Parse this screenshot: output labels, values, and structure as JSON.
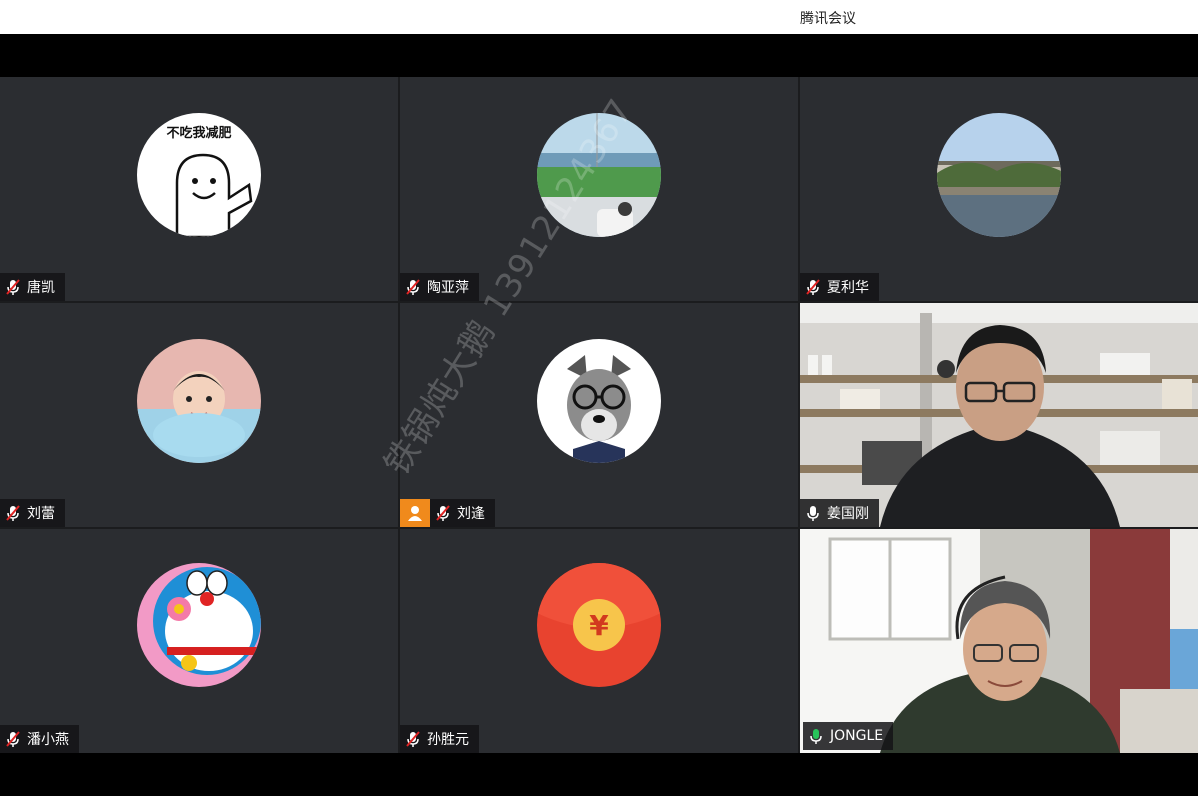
{
  "window": {
    "title": "腾讯会议"
  },
  "watermark": "铁锅炖大鹅 13912124367",
  "participants": [
    {
      "name": "唐凯",
      "avatar": "meme-face-avatar",
      "avatar_text": "不吃我减肥",
      "mic": "muted"
    },
    {
      "name": "陶亚萍",
      "avatar": "beach-resort-avatar",
      "mic": "muted"
    },
    {
      "name": "夏利华",
      "avatar": "river-town-avatar",
      "mic": "muted"
    },
    {
      "name": "刘蕾",
      "avatar": "child-photo-avatar",
      "mic": "muted"
    },
    {
      "name": "刘逢",
      "avatar": "dog-with-glasses-avatar",
      "mic": "muted",
      "badge": "user-icon"
    },
    {
      "name": "姜国刚",
      "video": "camera-on",
      "mic": "unmuted"
    },
    {
      "name": "潘小燕",
      "avatar": "doraemon-avatar",
      "mic": "muted"
    },
    {
      "name": "孙胜元",
      "avatar": "red-envelope-avatar",
      "avatar_text": "¥",
      "mic": "muted"
    },
    {
      "name": "JONGLE",
      "video": "camera-on",
      "mic": "speaking",
      "active": true
    }
  ],
  "colors": {
    "active_border": "#27c35a",
    "muted_icon": "#e02424",
    "badge": "#f08a1c"
  }
}
